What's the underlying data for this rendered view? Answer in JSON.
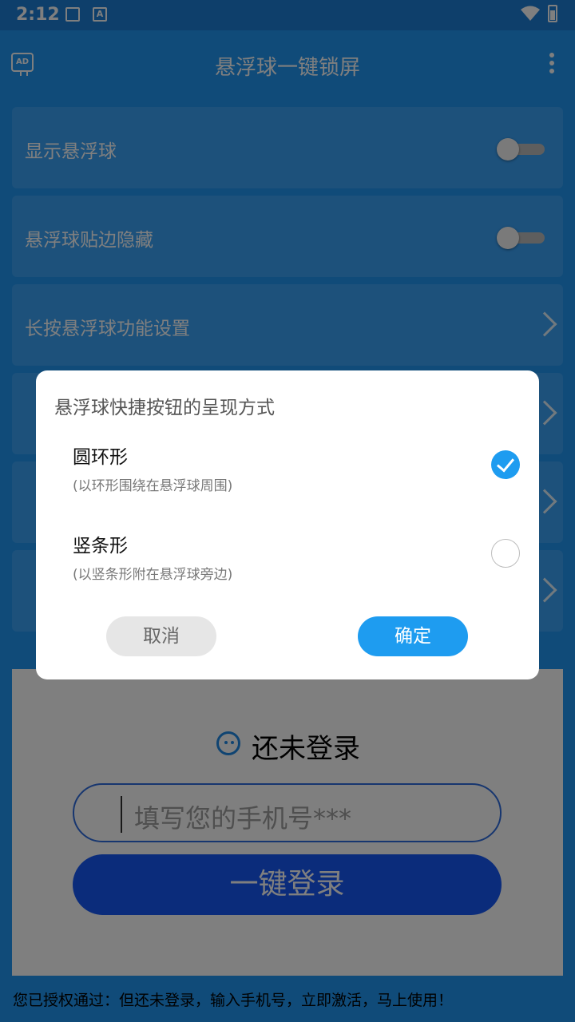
{
  "status_bar": {
    "time": "2:12"
  },
  "app_bar": {
    "ad_icon_text": "AD",
    "title": "悬浮球一键锁屏"
  },
  "settings": {
    "show_ball": {
      "label": "显示悬浮球",
      "enabled": false
    },
    "edge_hide": {
      "label": "悬浮球贴边隐藏",
      "enabled": false
    },
    "long_press": {
      "label": "长按悬浮球功能设置"
    }
  },
  "dialog": {
    "title": "悬浮球快捷按钮的呈现方式",
    "options": [
      {
        "label": "圆环形",
        "desc": "(以环形围绕在悬浮球周围)",
        "selected": true
      },
      {
        "label": "竖条形",
        "desc": "(以竖条形附在悬浮球旁边)",
        "selected": false
      }
    ],
    "cancel_label": "取消",
    "confirm_label": "确定"
  },
  "login": {
    "title": "还未登录",
    "phone_placeholder": "填写您的手机号***",
    "button_label": "一键登录"
  },
  "footer": {
    "tip": "您已授权通过：但还未登录，输入手机号，立即激活，马上使用！"
  },
  "colors": {
    "primary": "#2196f3",
    "accent": "#1e9cf0",
    "login_button": "#1759f7"
  }
}
